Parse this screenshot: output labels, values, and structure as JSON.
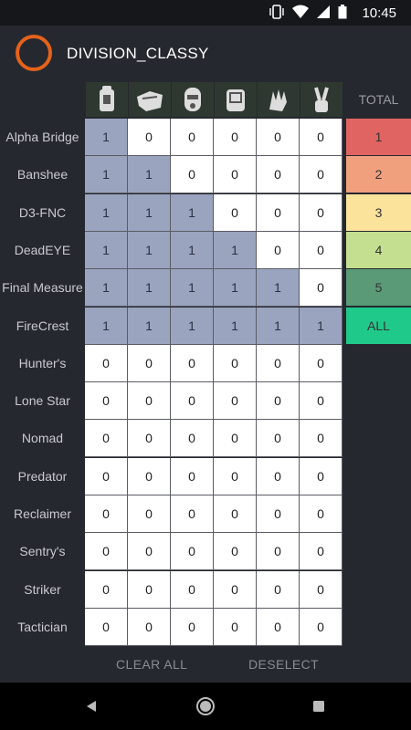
{
  "status": {
    "time": "10:45"
  },
  "app": {
    "title": "DIVISION_CLASSY"
  },
  "columns": [
    {
      "icon": "backpack-gear-icon"
    },
    {
      "icon": "gloves-gear-icon"
    },
    {
      "icon": "mask-gear-icon"
    },
    {
      "icon": "body-armor-gear-icon"
    },
    {
      "icon": "glove-gear-icon"
    },
    {
      "icon": "holster-gear-icon"
    }
  ],
  "total_header": "TOTAL",
  "rows": [
    {
      "label": "Alpha Bridge",
      "values": [
        1,
        0,
        0,
        0,
        0,
        0
      ]
    },
    {
      "label": "Banshee",
      "values": [
        1,
        1,
        0,
        0,
        0,
        0
      ]
    },
    {
      "label": "D3-FNC",
      "values": [
        1,
        1,
        1,
        0,
        0,
        0
      ]
    },
    {
      "label": "DeadEYE",
      "values": [
        1,
        1,
        1,
        1,
        0,
        0
      ]
    },
    {
      "label": "Final Measure",
      "values": [
        1,
        1,
        1,
        1,
        1,
        0
      ]
    },
    {
      "label": "FireCrest",
      "values": [
        1,
        1,
        1,
        1,
        1,
        1
      ]
    },
    {
      "label": "Hunter's",
      "values": [
        0,
        0,
        0,
        0,
        0,
        0
      ]
    },
    {
      "label": "Lone Star",
      "values": [
        0,
        0,
        0,
        0,
        0,
        0
      ]
    },
    {
      "label": "Nomad",
      "values": [
        0,
        0,
        0,
        0,
        0,
        0
      ]
    },
    {
      "label": "Predator",
      "values": [
        0,
        0,
        0,
        0,
        0,
        0
      ]
    },
    {
      "label": "Reclaimer",
      "values": [
        0,
        0,
        0,
        0,
        0,
        0
      ]
    },
    {
      "label": "Sentry's",
      "values": [
        0,
        0,
        0,
        0,
        0,
        0
      ]
    },
    {
      "label": "Striker",
      "values": [
        0,
        0,
        0,
        0,
        0,
        0
      ]
    },
    {
      "label": "Tactician",
      "values": [
        0,
        0,
        0,
        0,
        0,
        0
      ]
    }
  ],
  "totals": [
    {
      "label": "1",
      "color": "#e06461"
    },
    {
      "label": "2",
      "color": "#f1a07e"
    },
    {
      "label": "3",
      "color": "#fbe39b"
    },
    {
      "label": "4",
      "color": "#c4df8f"
    },
    {
      "label": "5",
      "color": "#5a9a77"
    },
    {
      "label": "ALL",
      "color": "#1fc98a"
    }
  ],
  "actions": {
    "clear_all": "CLEAR ALL",
    "deselect": "DESELECT"
  },
  "colors": {
    "accent": "#e4621c",
    "selected_cell": "#9aa4bf"
  }
}
